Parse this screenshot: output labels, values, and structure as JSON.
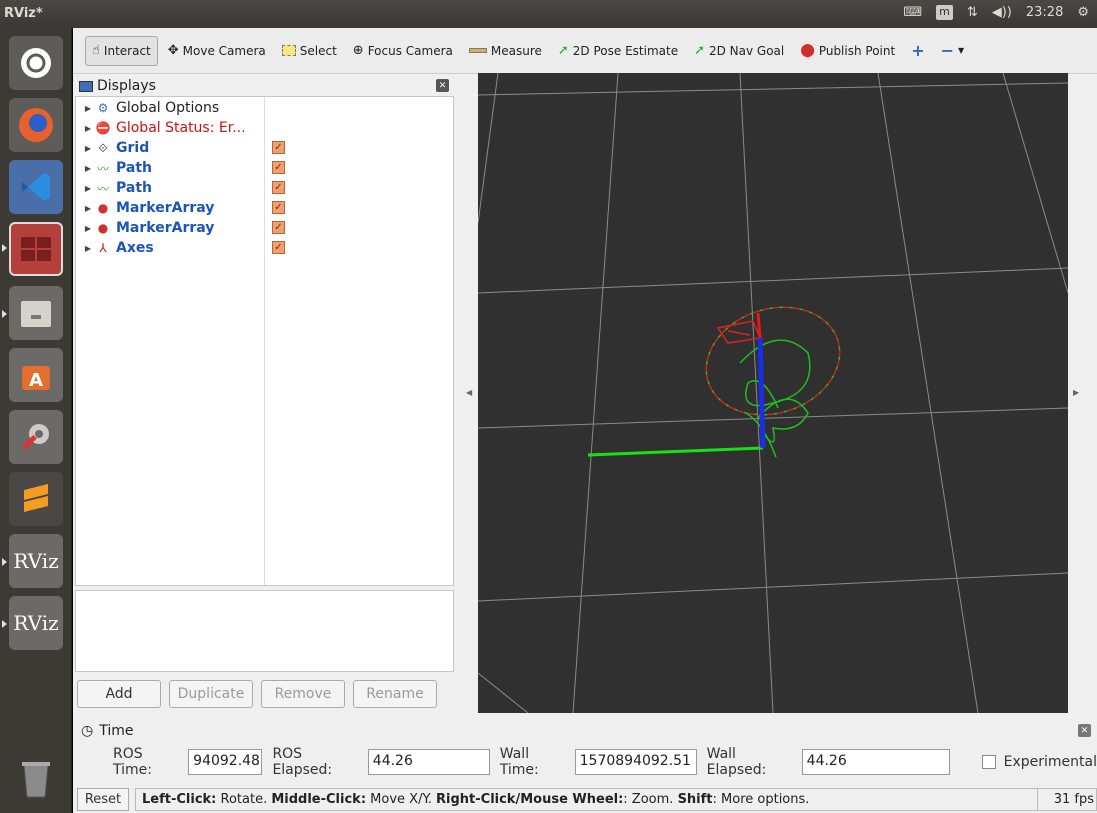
{
  "window": {
    "title": "RViz*",
    "clock": "23:28"
  },
  "toolbar": {
    "tools": [
      {
        "label": "Interact",
        "icon": "hand-icon"
      },
      {
        "label": "Move Camera",
        "icon": "move-camera-icon"
      },
      {
        "label": "Select",
        "icon": "select-icon"
      },
      {
        "label": "Focus Camera",
        "icon": "focus-camera-icon"
      },
      {
        "label": "Measure",
        "icon": "measure-icon"
      },
      {
        "label": "2D Pose Estimate",
        "icon": "pose-estimate-icon"
      },
      {
        "label": "2D Nav Goal",
        "icon": "nav-goal-icon"
      },
      {
        "label": "Publish Point",
        "icon": "publish-point-icon"
      }
    ]
  },
  "displays": {
    "title": "Displays",
    "items": [
      {
        "label": "Global Options",
        "color": "#222222",
        "bold": false,
        "checked": false
      },
      {
        "label": "Global Status: Er...",
        "color": "#cc1111",
        "bold": false,
        "checked": false
      },
      {
        "label": "Grid",
        "color": "#1b55b8",
        "bold": true,
        "checked": true
      },
      {
        "label": "Path",
        "color": "#1b55b8",
        "bold": true,
        "checked": true
      },
      {
        "label": "Path",
        "color": "#1b55b8",
        "bold": true,
        "checked": true
      },
      {
        "label": "MarkerArray",
        "color": "#1b55b8",
        "bold": true,
        "checked": true
      },
      {
        "label": "MarkerArray",
        "color": "#1b55b8",
        "bold": true,
        "checked": true
      },
      {
        "label": "Axes",
        "color": "#1b55b8",
        "bold": true,
        "checked": true
      }
    ],
    "buttons": {
      "add": "Add",
      "duplicate": "Duplicate",
      "remove": "Remove",
      "rename": "Rename"
    }
  },
  "time": {
    "title": "Time",
    "ros_time_label": "ROS Time:",
    "ros_time": "94092.48",
    "ros_elapsed_label": "ROS Elapsed:",
    "ros_elapsed": "44.26",
    "wall_time_label": "Wall Time:",
    "wall_time": "1570894092.51",
    "wall_elapsed_label": "Wall Elapsed:",
    "wall_elapsed": "44.26",
    "experimental_label": "Experimental"
  },
  "status": {
    "reset": "Reset",
    "lc": "Left-Click:",
    "lc_t": " Rotate. ",
    "mc": "Middle-Click:",
    "mc_t": " Move X/Y. ",
    "rc": "Right-Click/Mouse Wheel:",
    "rc_t": ": Zoom. ",
    "sh": "Shift",
    "sh_t": ": More options.",
    "fps": "31 fps"
  },
  "launcher": [
    "Ubuntu",
    "Firefox",
    "VS Code",
    "System Monitor",
    "Files",
    "Software",
    "Settings",
    "Sublime",
    "RViz",
    "RViz",
    "Trash"
  ],
  "launcher_text": {
    "rviz": "RViz"
  }
}
